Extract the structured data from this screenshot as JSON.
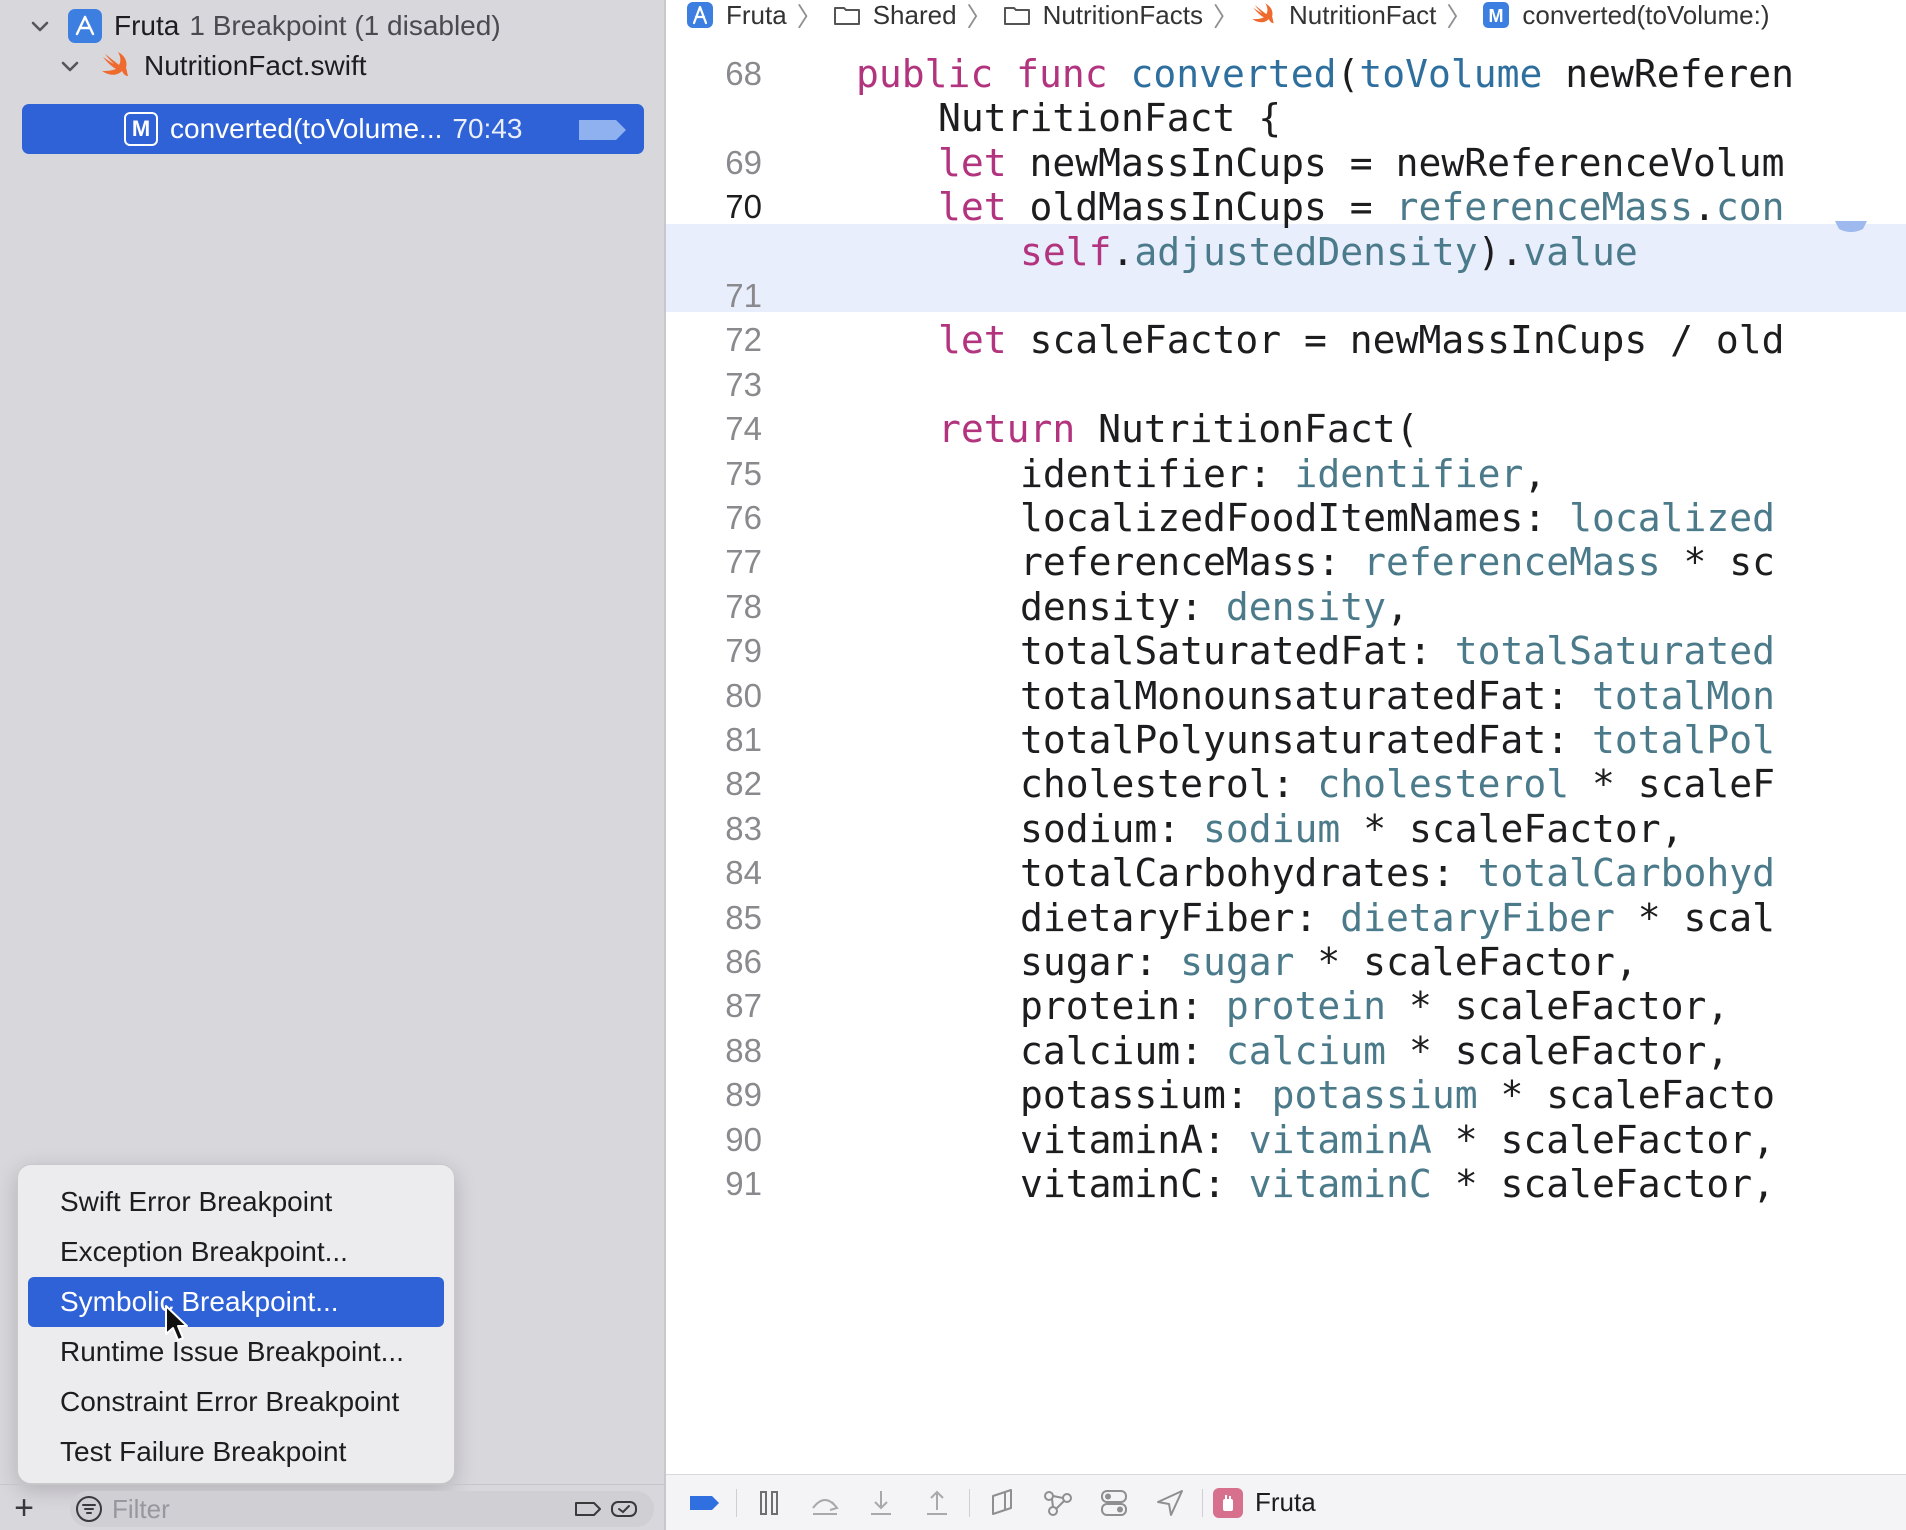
{
  "navigator": {
    "project_name": "Fruta",
    "project_summary": "1 Breakpoint (1 disabled)",
    "file_name": "NutritionFact.swift",
    "breakpoint": {
      "method_badge": "M",
      "label": "converted(toVolume...",
      "location": "70:43"
    },
    "filter_placeholder": "Filter",
    "add_label": "+"
  },
  "menu": {
    "items": [
      {
        "label": "Swift Error Breakpoint",
        "selected": false
      },
      {
        "label": "Exception Breakpoint...",
        "selected": false
      },
      {
        "label": "Symbolic Breakpoint...",
        "selected": true
      },
      {
        "label": "Runtime Issue Breakpoint...",
        "selected": false
      },
      {
        "label": "Constraint Error Breakpoint",
        "selected": false
      },
      {
        "label": "Test Failure Breakpoint",
        "selected": false
      }
    ]
  },
  "jumpbar": {
    "segments": [
      "Fruta",
      "Shared",
      "NutritionFacts",
      "NutritionFact",
      "converted(toVolume:)"
    ],
    "method_badge": "M"
  },
  "editor": {
    "current_line": "70",
    "lines": [
      {
        "n": "68",
        "tokens": [
          [
            "kw",
            "public "
          ],
          [
            "kw",
            "func "
          ],
          [
            "fn",
            "converted"
          ],
          [
            "tp",
            "("
          ],
          [
            "fn",
            "toVolume"
          ],
          [
            "tp",
            " newReferen"
          ]
        ]
      },
      {
        "n": "",
        "tokens": [
          [
            "tp",
            "NutritionFact {"
          ]
        ]
      },
      {
        "n": "69",
        "tokens": [
          [
            "kw",
            "let "
          ],
          [
            "tp",
            "newMassInCups = newReferenceVolum"
          ]
        ]
      },
      {
        "n": "70",
        "tokens": [
          [
            "kw",
            "let "
          ],
          [
            "tp",
            "oldMassInCups = "
          ],
          [
            "pv",
            "referenceMass"
          ],
          [
            "tp",
            "."
          ],
          [
            "pv",
            "con"
          ]
        ]
      },
      {
        "n": "",
        "tokens": [
          [
            "kw",
            "self"
          ],
          [
            "tp",
            "."
          ],
          [
            "pv",
            "adjustedDensity"
          ],
          [
            "tp",
            ")."
          ],
          [
            "pv",
            "value"
          ]
        ]
      },
      {
        "n": "71",
        "tokens": []
      },
      {
        "n": "72",
        "tokens": [
          [
            "kw",
            "let "
          ],
          [
            "tp",
            "scaleFactor = newMassInCups / old"
          ]
        ]
      },
      {
        "n": "73",
        "tokens": []
      },
      {
        "n": "74",
        "tokens": [
          [
            "kw",
            "return "
          ],
          [
            "tp",
            "NutritionFact("
          ]
        ]
      },
      {
        "n": "75",
        "tokens": [
          [
            "tp",
            "identifier: "
          ],
          [
            "pv",
            "identifier"
          ],
          [
            "tp",
            ","
          ]
        ]
      },
      {
        "n": "76",
        "tokens": [
          [
            "tp",
            "localizedFoodItemNames: "
          ],
          [
            "pv",
            "localized"
          ]
        ]
      },
      {
        "n": "77",
        "tokens": [
          [
            "tp",
            "referenceMass: "
          ],
          [
            "pv",
            "referenceMass"
          ],
          [
            "tp",
            " * sc"
          ]
        ]
      },
      {
        "n": "78",
        "tokens": [
          [
            "tp",
            "density: "
          ],
          [
            "pv",
            "density"
          ],
          [
            "tp",
            ","
          ]
        ]
      },
      {
        "n": "79",
        "tokens": [
          [
            "tp",
            "totalSaturatedFat: "
          ],
          [
            "pv",
            "totalSaturated"
          ]
        ]
      },
      {
        "n": "80",
        "tokens": [
          [
            "tp",
            "totalMonounsaturatedFat: "
          ],
          [
            "pv",
            "totalMon"
          ]
        ]
      },
      {
        "n": "81",
        "tokens": [
          [
            "tp",
            "totalPolyunsaturatedFat: "
          ],
          [
            "pv",
            "totalPol"
          ]
        ]
      },
      {
        "n": "82",
        "tokens": [
          [
            "tp",
            "cholesterol: "
          ],
          [
            "pv",
            "cholesterol"
          ],
          [
            "tp",
            " * scaleF"
          ]
        ]
      },
      {
        "n": "83",
        "tokens": [
          [
            "tp",
            "sodium: "
          ],
          [
            "pv",
            "sodium"
          ],
          [
            "tp",
            " * scaleFactor,"
          ]
        ]
      },
      {
        "n": "84",
        "tokens": [
          [
            "tp",
            "totalCarbohydrates: "
          ],
          [
            "pv",
            "totalCarbohyd"
          ]
        ]
      },
      {
        "n": "85",
        "tokens": [
          [
            "tp",
            "dietaryFiber: "
          ],
          [
            "pv",
            "dietaryFiber"
          ],
          [
            "tp",
            " * scal"
          ]
        ]
      },
      {
        "n": "86",
        "tokens": [
          [
            "tp",
            "sugar: "
          ],
          [
            "pv",
            "sugar"
          ],
          [
            "tp",
            " * scaleFactor,"
          ]
        ]
      },
      {
        "n": "87",
        "tokens": [
          [
            "tp",
            "protein: "
          ],
          [
            "pv",
            "protein"
          ],
          [
            "tp",
            " * scaleFactor,"
          ]
        ]
      },
      {
        "n": "88",
        "tokens": [
          [
            "tp",
            "calcium: "
          ],
          [
            "pv",
            "calcium"
          ],
          [
            "tp",
            " * scaleFactor,"
          ]
        ]
      },
      {
        "n": "89",
        "tokens": [
          [
            "tp",
            "potassium: "
          ],
          [
            "pv",
            "potassium"
          ],
          [
            "tp",
            " * scaleFacto"
          ]
        ]
      },
      {
        "n": "90",
        "tokens": [
          [
            "tp",
            "vitaminA: "
          ],
          [
            "pv",
            "vitaminA"
          ],
          [
            "tp",
            " * scaleFactor,"
          ]
        ]
      },
      {
        "n": "91",
        "tokens": [
          [
            "tp",
            "vitaminC: "
          ],
          [
            "pv",
            "vitaminC"
          ],
          [
            "tp",
            " * scaleFactor,"
          ]
        ]
      }
    ]
  },
  "debugbar": {
    "scheme": "Fruta",
    "buttons": [
      "breakpoints-toggle-icon",
      "pause-icon",
      "step-over-icon",
      "step-into-icon",
      "step-out-icon",
      "view-hierarchy-icon",
      "memory-graph-icon",
      "environment-overrides-icon",
      "simulate-location-icon"
    ]
  },
  "colors": {
    "selection": "#2f62d6",
    "keyword": "#b3347e",
    "function": "#2e6f9e",
    "property": "#4b7a8a",
    "current_line_bg": "#e8eefb",
    "navigator_bg": "#d8d7dc"
  }
}
